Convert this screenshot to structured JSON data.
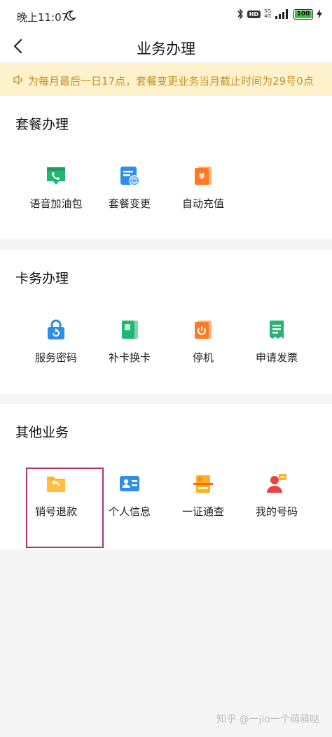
{
  "status_bar": {
    "time": "晚上11:07",
    "hd_badge": "HD",
    "network_5g": "5G",
    "network_4g": "4G",
    "battery_level": "100",
    "icons": [
      "moon-icon",
      "bluetooth-icon",
      "signal-icon",
      "battery-icon",
      "charging-icon"
    ]
  },
  "nav": {
    "back_icon": "back-arrow-icon",
    "title": "业务办理"
  },
  "notice": {
    "icon": "speaker-icon",
    "text": "为每月最后一日17点，套餐变更业务当月截止时间为29号0点"
  },
  "sections": [
    {
      "title": "套餐办理",
      "items": [
        {
          "label": "语音加油包",
          "icon": "phone-chat-icon",
          "color": "#22b573"
        },
        {
          "label": "套餐变更",
          "icon": "plan-change-icon",
          "color": "#2f8ee6"
        },
        {
          "label": "自动充值",
          "icon": "yuan-card-icon",
          "color": "#ff7a22"
        }
      ]
    },
    {
      "title": "卡务办理",
      "items": [
        {
          "label": "服务密码",
          "icon": "lock-icon",
          "color": "#2f8ee6"
        },
        {
          "label": "补卡换卡",
          "icon": "sim-card-icon",
          "color": "#22b573"
        },
        {
          "label": "停机",
          "icon": "power-card-icon",
          "color": "#ff7a22"
        },
        {
          "label": "申请发票",
          "icon": "receipt-icon",
          "color": "#22b573"
        }
      ]
    },
    {
      "title": "其他业务",
      "items": [
        {
          "label": "销号退款",
          "icon": "refund-folder-icon",
          "color": "#ffb21e"
        },
        {
          "label": "个人信息",
          "icon": "id-card-icon",
          "color": "#2f8ee6"
        },
        {
          "label": "一证通查",
          "icon": "scan-card-icon",
          "color": "#ff8a22"
        },
        {
          "label": "我的号码",
          "icon": "user-number-icon",
          "color": "#e84141"
        }
      ]
    }
  ],
  "watermark": "知乎 @一jio一个萌萌哒"
}
